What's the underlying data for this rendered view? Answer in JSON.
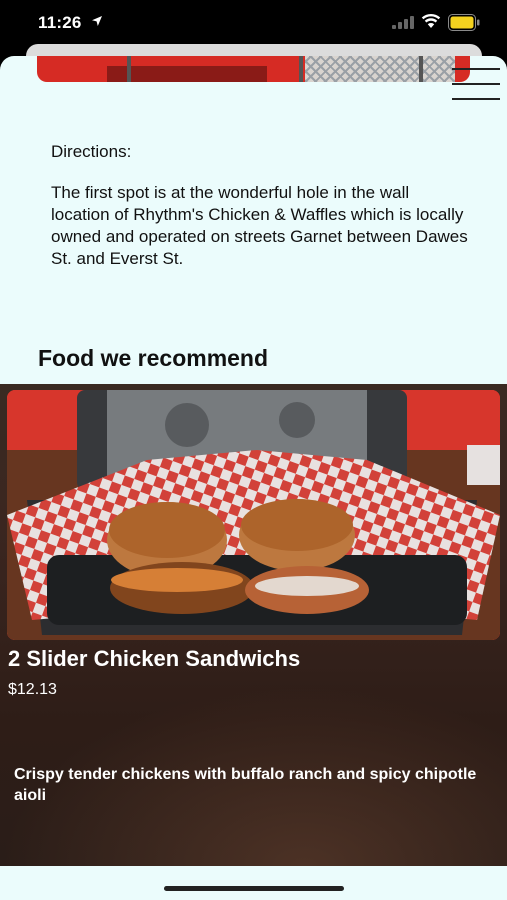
{
  "status_bar": {
    "time": "11:26",
    "icons": [
      "location-arrow-icon",
      "cellular-signal-icon",
      "wifi-icon",
      "battery-icon"
    ],
    "battery_color": "#f4d21f"
  },
  "menu": {
    "icon": "hamburger-menu-icon"
  },
  "directions": {
    "heading": "Directions:",
    "text": "The first spot is at the wonderful hole in the wall location of Rhythm's Chicken & Waffles which is locally owned and operated on streets Garnet between Dawes St. and Everst St."
  },
  "recommend": {
    "title": "Food we recommend",
    "item": {
      "name": "2 Slider Chicken Sandwichs",
      "price": "$12.13",
      "description": "Crispy tender chickens with buffalo ranch and spicy chipotle aioli"
    }
  },
  "colors": {
    "sheet_background": "#ebfcfc",
    "card_background": "#3a2a22",
    "text_dark": "#111111",
    "text_light": "#ffffff"
  }
}
